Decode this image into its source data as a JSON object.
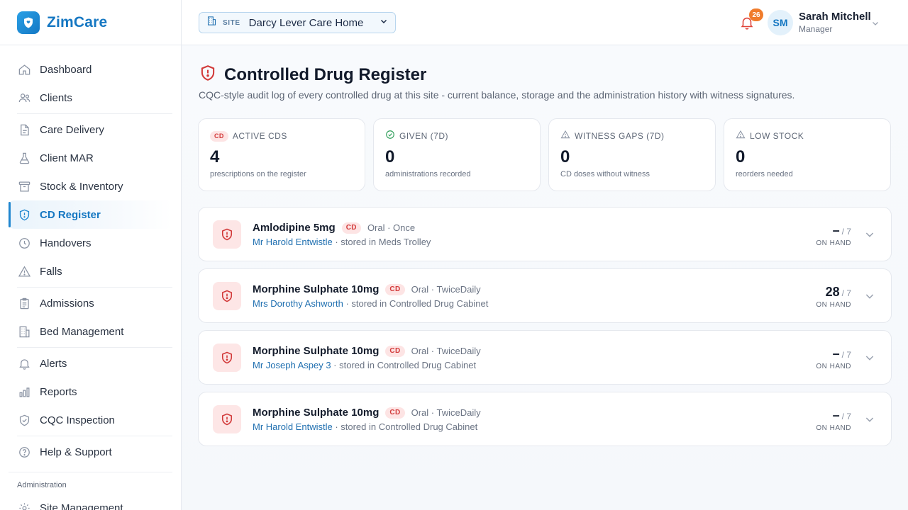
{
  "brand": {
    "name": "ZimCare"
  },
  "sidebar": {
    "items": [
      {
        "label": "Dashboard",
        "icon": "home-icon"
      },
      {
        "label": "Clients",
        "icon": "users-icon"
      },
      {
        "label": "Care Delivery",
        "icon": "document-icon"
      },
      {
        "label": "Client MAR",
        "icon": "flask-icon"
      },
      {
        "label": "Stock & Inventory",
        "icon": "archive-icon"
      },
      {
        "label": "CD Register",
        "icon": "shield-alert-icon",
        "active": true
      },
      {
        "label": "Handovers",
        "icon": "clock-icon"
      },
      {
        "label": "Falls",
        "icon": "warning-icon"
      },
      {
        "label": "Admissions",
        "icon": "clipboard-icon"
      },
      {
        "label": "Bed Management",
        "icon": "building-icon"
      },
      {
        "label": "Alerts",
        "icon": "bell-icon"
      },
      {
        "label": "Reports",
        "icon": "bar-chart-icon"
      },
      {
        "label": "CQC Inspection",
        "icon": "shield-check-icon"
      },
      {
        "label": "Help & Support",
        "icon": "help-circle-icon"
      }
    ],
    "admin_label": "Administration",
    "admin_items": [
      {
        "label": "Site Management",
        "icon": "gear-icon"
      }
    ]
  },
  "topbar": {
    "site_tag": "SITE",
    "site_name": "Darcy Lever Care Home",
    "notification_count": "26",
    "user": {
      "initials": "SM",
      "name": "Sarah Mitchell",
      "role": "Manager"
    }
  },
  "page": {
    "title": "Controlled Drug Register",
    "subtitle": "CQC-style audit log of every controlled drug at this site - current balance, storage and the administration history with witness signatures."
  },
  "stats": [
    {
      "label": "ACTIVE CDS",
      "value": "4",
      "note": "prescriptions on the register",
      "icon": "cd-badge",
      "pill": "CD"
    },
    {
      "label": "GIVEN (7D)",
      "value": "0",
      "note": "administrations recorded",
      "icon": "check-circle-icon"
    },
    {
      "label": "WITNESS GAPS (7D)",
      "value": "0",
      "note": "CD doses without witness",
      "icon": "warning-icon"
    },
    {
      "label": "LOW STOCK",
      "value": "0",
      "note": "reorders needed",
      "icon": "warning-icon"
    }
  ],
  "register": {
    "cd_label": "CD",
    "on_hand_label": "ON HAND",
    "rows": [
      {
        "drug": "Amlodipine 5mg",
        "route": "Oral · Once",
        "client": "Mr Harold Entwistle",
        "storage": " · stored in Meds Trolley",
        "on_hand": "–",
        "total": "/ 7"
      },
      {
        "drug": "Morphine Sulphate 10mg",
        "route": "Oral · TwiceDaily",
        "client": "Mrs Dorothy Ashworth",
        "storage": " · stored in Controlled Drug Cabinet",
        "on_hand": "28",
        "total": "/ 7"
      },
      {
        "drug": "Morphine Sulphate 10mg",
        "route": "Oral · TwiceDaily",
        "client": "Mr Joseph Aspey 3",
        "storage": " · stored in Controlled Drug Cabinet",
        "on_hand": "–",
        "total": "/ 7"
      },
      {
        "drug": "Morphine Sulphate 10mg",
        "route": "Oral · TwiceDaily",
        "client": "Mr Harold Entwistle",
        "storage": " · stored in Controlled Drug Cabinet",
        "on_hand": "–",
        "total": "/ 7"
      }
    ]
  },
  "colors": {
    "brand": "#1577c2",
    "accent": "#1f86cf",
    "cd_red": "#d23a3a",
    "badge_orange": "#f07c2c"
  }
}
